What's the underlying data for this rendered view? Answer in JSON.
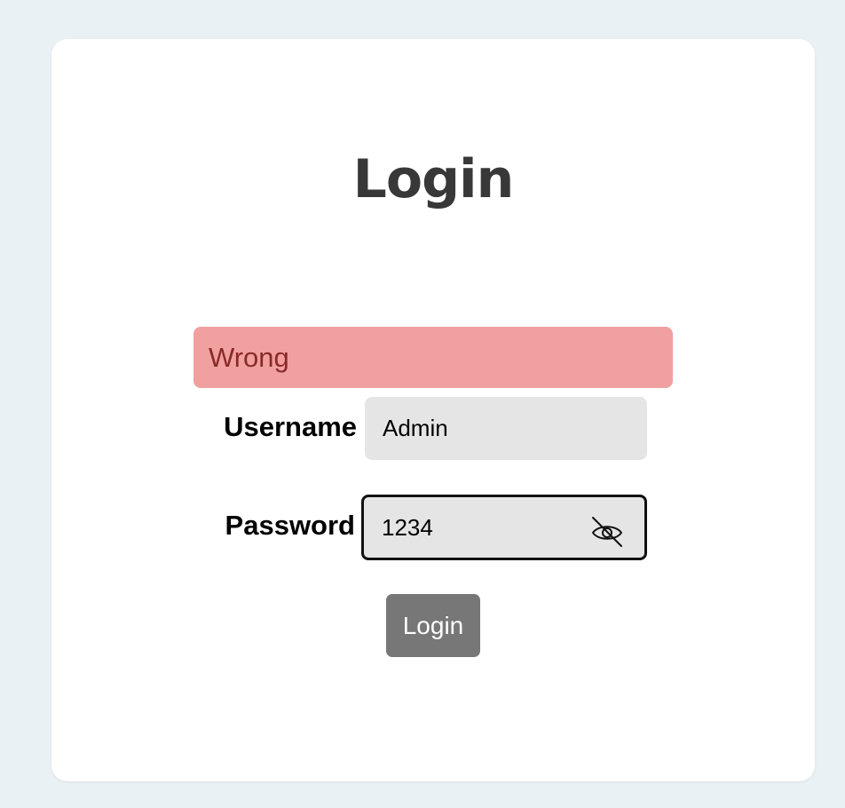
{
  "page": {
    "title": "Login"
  },
  "error": {
    "message": "Wrong",
    "background": "#f1a0a0",
    "text_color": "#8a2a2a"
  },
  "form": {
    "username_label": "Username",
    "username_value": "Admin",
    "password_label": "Password",
    "password_value": "1234",
    "password_toggle_icon": "eye-off-icon",
    "submit_label": "Login",
    "submit_color": "#777777"
  }
}
